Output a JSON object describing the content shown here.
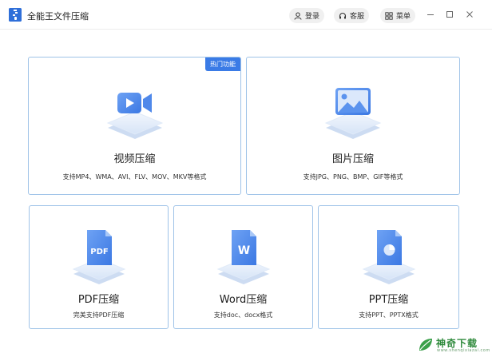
{
  "app": {
    "title": "全能王文件压缩",
    "logo_icon": "zipper-file-icon",
    "accent_color": "#2f6fd9"
  },
  "titlebar": {
    "login_label": "登录",
    "service_label": "客服",
    "menu_label": "菜单",
    "login_icon": "user-icon",
    "service_icon": "headset-icon",
    "menu_icon": "grid-icon",
    "minimize_icon": "minimize-icon",
    "maximize_icon": "maximize-icon",
    "close_icon": "close-icon"
  },
  "cards": {
    "video": {
      "badge": "热门功能",
      "title": "视频压缩",
      "desc": "支持MP4、WMA、AVI、FLV、MOV、MKV等格式",
      "icon": "video-camera-icon"
    },
    "image": {
      "title": "图片压缩",
      "desc": "支持JPG、PNG、BMP、GIF等格式",
      "icon": "image-icon"
    },
    "pdf": {
      "title": "PDF压缩",
      "desc": "完美支持PDF压缩",
      "icon_text": "PDF",
      "icon": "pdf-file-icon"
    },
    "word": {
      "title": "Word压缩",
      "desc": "支持doc、docx格式",
      "icon_text": "W",
      "icon": "word-file-icon"
    },
    "ppt": {
      "title": "PPT压缩",
      "desc": "支持PPT、PPTX格式",
      "icon": "ppt-file-icon"
    }
  },
  "watermark": {
    "text": "神奇下载",
    "sub": "www.shenqixiazai.com"
  }
}
